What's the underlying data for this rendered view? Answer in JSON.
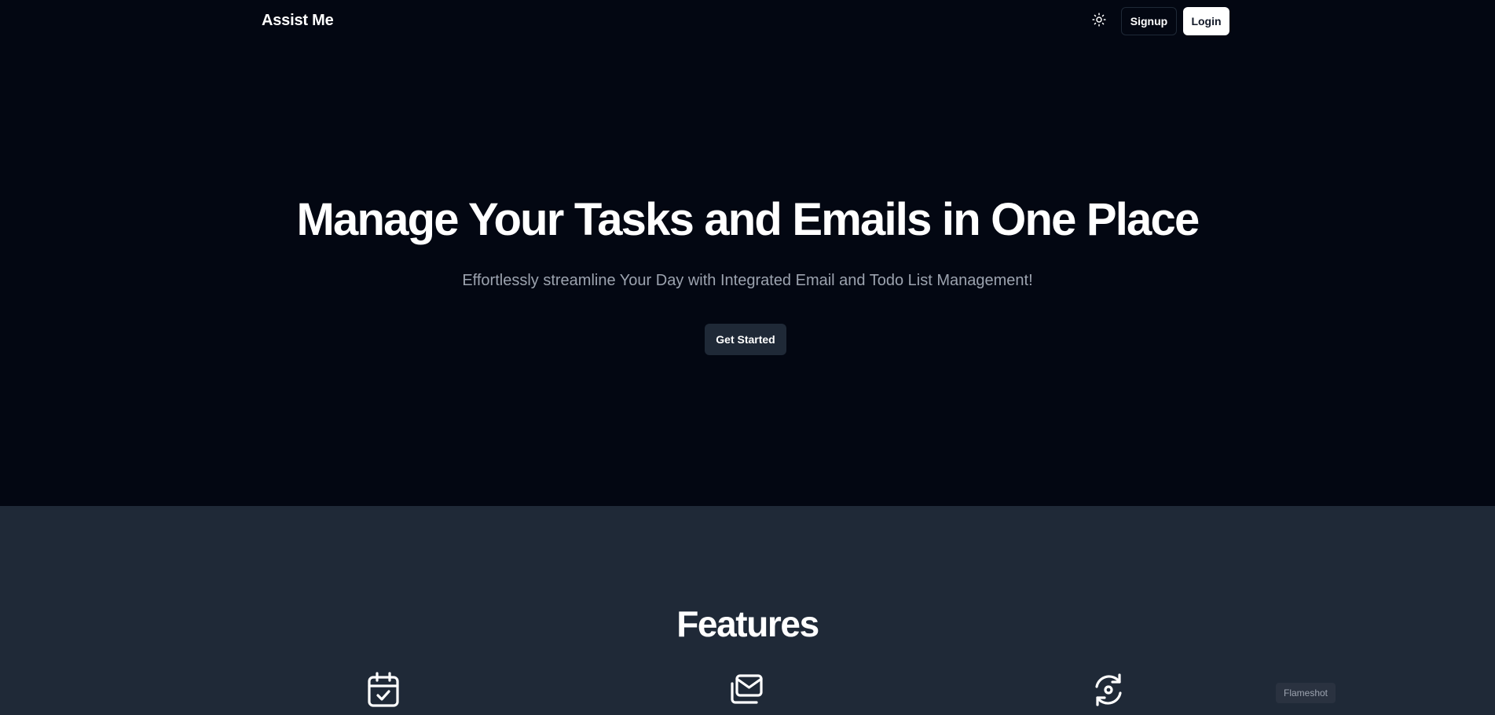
{
  "navbar": {
    "brand": "Assist Me",
    "theme_icon": "sun-icon",
    "signup_label": "Signup",
    "login_label": "Login"
  },
  "hero": {
    "title": "Manage Your Tasks and Emails in One Place",
    "subtitle": "Effortlessly streamline Your Day with Integrated Email and Todo List Management!",
    "cta_label": "Get Started"
  },
  "features": {
    "title": "Features",
    "icons": [
      "calendar-check-icon",
      "mail-stack-icon",
      "sync-icon"
    ]
  },
  "overlay": {
    "tag": "Flameshot"
  },
  "colors": {
    "hero_bg": "#030712",
    "features_bg": "#1f2937",
    "subtitle_text": "#9ca3af",
    "cta_bg": "#1f2937",
    "login_bg": "#ffffff"
  }
}
